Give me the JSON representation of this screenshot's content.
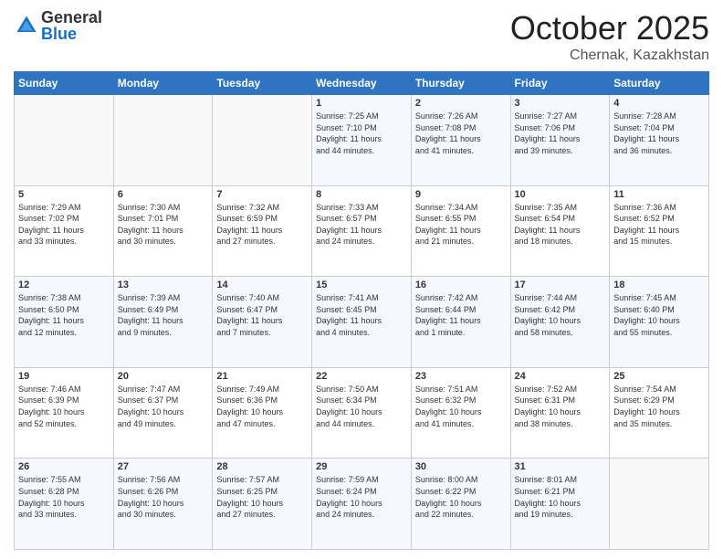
{
  "logo": {
    "general": "General",
    "blue": "Blue"
  },
  "header": {
    "month": "October 2025",
    "location": "Chernak, Kazakhstan"
  },
  "weekdays": [
    "Sunday",
    "Monday",
    "Tuesday",
    "Wednesday",
    "Thursday",
    "Friday",
    "Saturday"
  ],
  "weeks": [
    [
      {
        "day": "",
        "info": ""
      },
      {
        "day": "",
        "info": ""
      },
      {
        "day": "",
        "info": ""
      },
      {
        "day": "1",
        "info": "Sunrise: 7:25 AM\nSunset: 7:10 PM\nDaylight: 11 hours\nand 44 minutes."
      },
      {
        "day": "2",
        "info": "Sunrise: 7:26 AM\nSunset: 7:08 PM\nDaylight: 11 hours\nand 41 minutes."
      },
      {
        "day": "3",
        "info": "Sunrise: 7:27 AM\nSunset: 7:06 PM\nDaylight: 11 hours\nand 39 minutes."
      },
      {
        "day": "4",
        "info": "Sunrise: 7:28 AM\nSunset: 7:04 PM\nDaylight: 11 hours\nand 36 minutes."
      }
    ],
    [
      {
        "day": "5",
        "info": "Sunrise: 7:29 AM\nSunset: 7:02 PM\nDaylight: 11 hours\nand 33 minutes."
      },
      {
        "day": "6",
        "info": "Sunrise: 7:30 AM\nSunset: 7:01 PM\nDaylight: 11 hours\nand 30 minutes."
      },
      {
        "day": "7",
        "info": "Sunrise: 7:32 AM\nSunset: 6:59 PM\nDaylight: 11 hours\nand 27 minutes."
      },
      {
        "day": "8",
        "info": "Sunrise: 7:33 AM\nSunset: 6:57 PM\nDaylight: 11 hours\nand 24 minutes."
      },
      {
        "day": "9",
        "info": "Sunrise: 7:34 AM\nSunset: 6:55 PM\nDaylight: 11 hours\nand 21 minutes."
      },
      {
        "day": "10",
        "info": "Sunrise: 7:35 AM\nSunset: 6:54 PM\nDaylight: 11 hours\nand 18 minutes."
      },
      {
        "day": "11",
        "info": "Sunrise: 7:36 AM\nSunset: 6:52 PM\nDaylight: 11 hours\nand 15 minutes."
      }
    ],
    [
      {
        "day": "12",
        "info": "Sunrise: 7:38 AM\nSunset: 6:50 PM\nDaylight: 11 hours\nand 12 minutes."
      },
      {
        "day": "13",
        "info": "Sunrise: 7:39 AM\nSunset: 6:49 PM\nDaylight: 11 hours\nand 9 minutes."
      },
      {
        "day": "14",
        "info": "Sunrise: 7:40 AM\nSunset: 6:47 PM\nDaylight: 11 hours\nand 7 minutes."
      },
      {
        "day": "15",
        "info": "Sunrise: 7:41 AM\nSunset: 6:45 PM\nDaylight: 11 hours\nand 4 minutes."
      },
      {
        "day": "16",
        "info": "Sunrise: 7:42 AM\nSunset: 6:44 PM\nDaylight: 11 hours\nand 1 minute."
      },
      {
        "day": "17",
        "info": "Sunrise: 7:44 AM\nSunset: 6:42 PM\nDaylight: 10 hours\nand 58 minutes."
      },
      {
        "day": "18",
        "info": "Sunrise: 7:45 AM\nSunset: 6:40 PM\nDaylight: 10 hours\nand 55 minutes."
      }
    ],
    [
      {
        "day": "19",
        "info": "Sunrise: 7:46 AM\nSunset: 6:39 PM\nDaylight: 10 hours\nand 52 minutes."
      },
      {
        "day": "20",
        "info": "Sunrise: 7:47 AM\nSunset: 6:37 PM\nDaylight: 10 hours\nand 49 minutes."
      },
      {
        "day": "21",
        "info": "Sunrise: 7:49 AM\nSunset: 6:36 PM\nDaylight: 10 hours\nand 47 minutes."
      },
      {
        "day": "22",
        "info": "Sunrise: 7:50 AM\nSunset: 6:34 PM\nDaylight: 10 hours\nand 44 minutes."
      },
      {
        "day": "23",
        "info": "Sunrise: 7:51 AM\nSunset: 6:32 PM\nDaylight: 10 hours\nand 41 minutes."
      },
      {
        "day": "24",
        "info": "Sunrise: 7:52 AM\nSunset: 6:31 PM\nDaylight: 10 hours\nand 38 minutes."
      },
      {
        "day": "25",
        "info": "Sunrise: 7:54 AM\nSunset: 6:29 PM\nDaylight: 10 hours\nand 35 minutes."
      }
    ],
    [
      {
        "day": "26",
        "info": "Sunrise: 7:55 AM\nSunset: 6:28 PM\nDaylight: 10 hours\nand 33 minutes."
      },
      {
        "day": "27",
        "info": "Sunrise: 7:56 AM\nSunset: 6:26 PM\nDaylight: 10 hours\nand 30 minutes."
      },
      {
        "day": "28",
        "info": "Sunrise: 7:57 AM\nSunset: 6:25 PM\nDaylight: 10 hours\nand 27 minutes."
      },
      {
        "day": "29",
        "info": "Sunrise: 7:59 AM\nSunset: 6:24 PM\nDaylight: 10 hours\nand 24 minutes."
      },
      {
        "day": "30",
        "info": "Sunrise: 8:00 AM\nSunset: 6:22 PM\nDaylight: 10 hours\nand 22 minutes."
      },
      {
        "day": "31",
        "info": "Sunrise: 8:01 AM\nSunset: 6:21 PM\nDaylight: 10 hours\nand 19 minutes."
      },
      {
        "day": "",
        "info": ""
      }
    ]
  ]
}
